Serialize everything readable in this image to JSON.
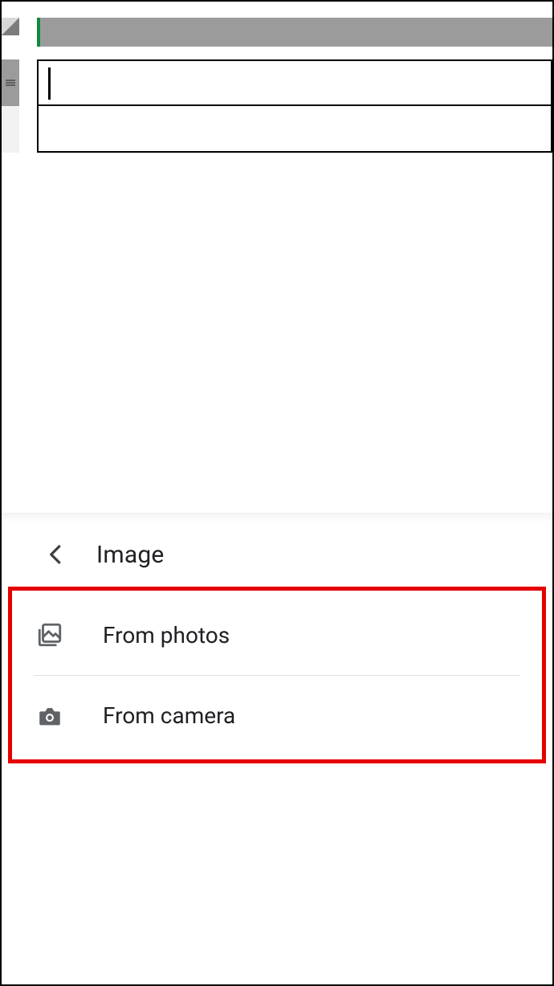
{
  "sheet": {
    "active_cell_value": "",
    "cursor_visible": true
  },
  "bottom_sheet": {
    "title": "Image",
    "items": [
      {
        "icon": "photos-icon",
        "label": "From photos"
      },
      {
        "icon": "camera-icon",
        "label": "From camera"
      }
    ]
  },
  "annotation": {
    "highlight_color": "#e40000"
  }
}
